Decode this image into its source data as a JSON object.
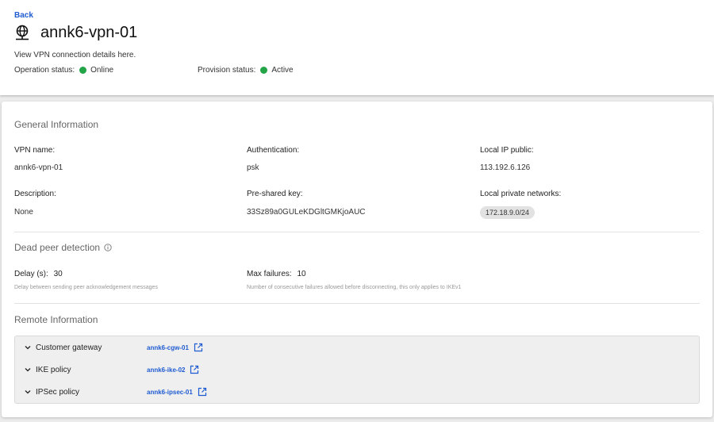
{
  "header": {
    "back_label": "Back",
    "title": "annk6-vpn-01",
    "subtitle": "View VPN connection details here.",
    "operation_status_label": "Operation status:",
    "operation_status_value": "Online",
    "provision_status_label": "Provision status:",
    "provision_status_value": "Active",
    "status_color": "#22a447",
    "title_icon": "globe-network-icon"
  },
  "general": {
    "title": "General Information",
    "vpn_name_label": "VPN name:",
    "vpn_name_value": "annk6-vpn-01",
    "authentication_label": "Authentication:",
    "authentication_value": "psk",
    "local_ip_label": "Local IP public:",
    "local_ip_value": "113.192.6.126",
    "description_label": "Description:",
    "description_value": "None",
    "psk_label": "Pre-shared key:",
    "psk_value": "33Sz89a0GULeKDGltGMKjoAUC",
    "local_private_label": "Local private networks:",
    "local_private_networks": [
      "172.18.9.0/24"
    ]
  },
  "dpd": {
    "title": "Dead peer detection",
    "delay_label": "Delay (s):",
    "delay_value": "30",
    "delay_hint": "Delay between sending peer acknowledgement messages",
    "max_failures_label": "Max failures:",
    "max_failures_value": "10",
    "max_failures_hint": "Number of consecutive failures allowed before disconnecting, this only applies to IKEv1"
  },
  "remote": {
    "title": "Remote Information",
    "items": [
      {
        "label": "Customer gateway",
        "link": "annk6-cgw-01"
      },
      {
        "label": "IKE policy",
        "link": "annk6-ike-02"
      },
      {
        "label": "IPSec policy",
        "link": "annk6-ipsec-01"
      }
    ]
  },
  "colors": {
    "link": "#1f5bd1",
    "status_green": "#22a447"
  }
}
